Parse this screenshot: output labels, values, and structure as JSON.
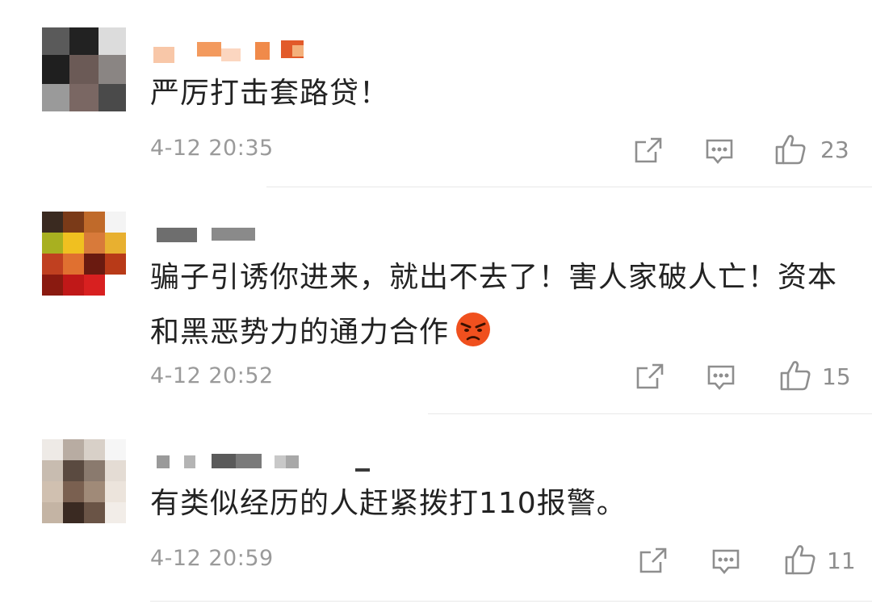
{
  "comments": [
    {
      "text": "严厉打击套路贷！",
      "time": "4-12 20:35",
      "likes": "23"
    },
    {
      "text": "骗子引诱你进来，就出不去了！害人家破人亡！资本和黑恶势力的通力合作",
      "emoji": "angry-face",
      "time": "4-12 20:52",
      "likes": "15"
    },
    {
      "text": "有类似经历的人赶紧拨打110报警。",
      "time": "4-12 20:59",
      "likes": "11"
    }
  ],
  "icons": {
    "share": "share-icon",
    "reply": "reply-icon",
    "like": "thumbs-up-icon"
  },
  "colors": {
    "text": "#222222",
    "meta": "#9a9a9a",
    "icon": "#8e8e8e",
    "divider": "#e8e8e8"
  }
}
